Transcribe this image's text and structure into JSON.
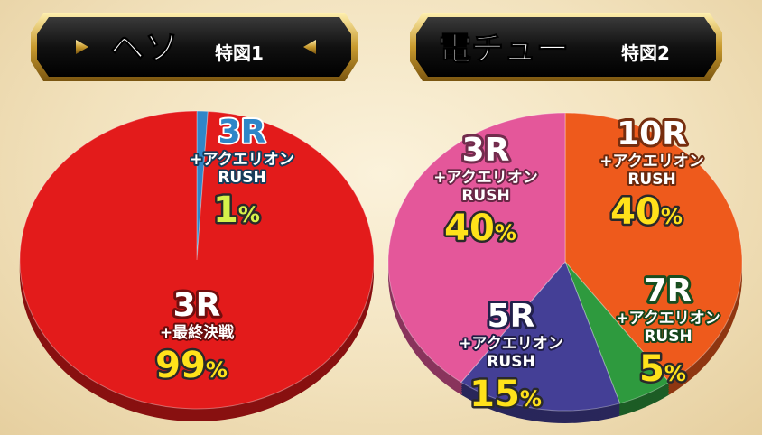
{
  "headers": [
    {
      "main": "ヘソ",
      "sub": "特図1"
    },
    {
      "main": "電チュー",
      "sub": "特図2"
    }
  ],
  "chart_data": [
    {
      "type": "pie",
      "title": "ヘソ",
      "subtitle": "特図1",
      "slices": [
        {
          "label": "3R",
          "sublabel": "+アクエリオン",
          "sublabel2": "RUSH",
          "value": 1,
          "value_text": "1",
          "unit": "%",
          "color": "#2f86c8"
        },
        {
          "label": "3R",
          "sublabel": "+最終決戦",
          "sublabel2": "",
          "value": 99,
          "value_text": "99",
          "unit": "%",
          "color": "#e31b1b"
        }
      ]
    },
    {
      "type": "pie",
      "title": "電チュー",
      "subtitle": "特図2",
      "slices": [
        {
          "label": "10R",
          "sublabel": "+アクエリオン",
          "sublabel2": "RUSH",
          "value": 40,
          "value_text": "40",
          "unit": "%",
          "color": "#ee5a1c"
        },
        {
          "label": "7R",
          "sublabel": "+アクエリオン",
          "sublabel2": "RUSH",
          "value": 5,
          "value_text": "5",
          "unit": "%",
          "color": "#2e9a3e"
        },
        {
          "label": "5R",
          "sublabel": "+アクエリオン",
          "sublabel2": "RUSH",
          "value": 15,
          "value_text": "15",
          "unit": "%",
          "color": "#443f96"
        },
        {
          "label": "3R",
          "sublabel": "+アクエリオン",
          "sublabel2": "RUSH",
          "value": 40,
          "value_text": "40",
          "unit": "%",
          "color": "#e4579a"
        }
      ]
    }
  ]
}
